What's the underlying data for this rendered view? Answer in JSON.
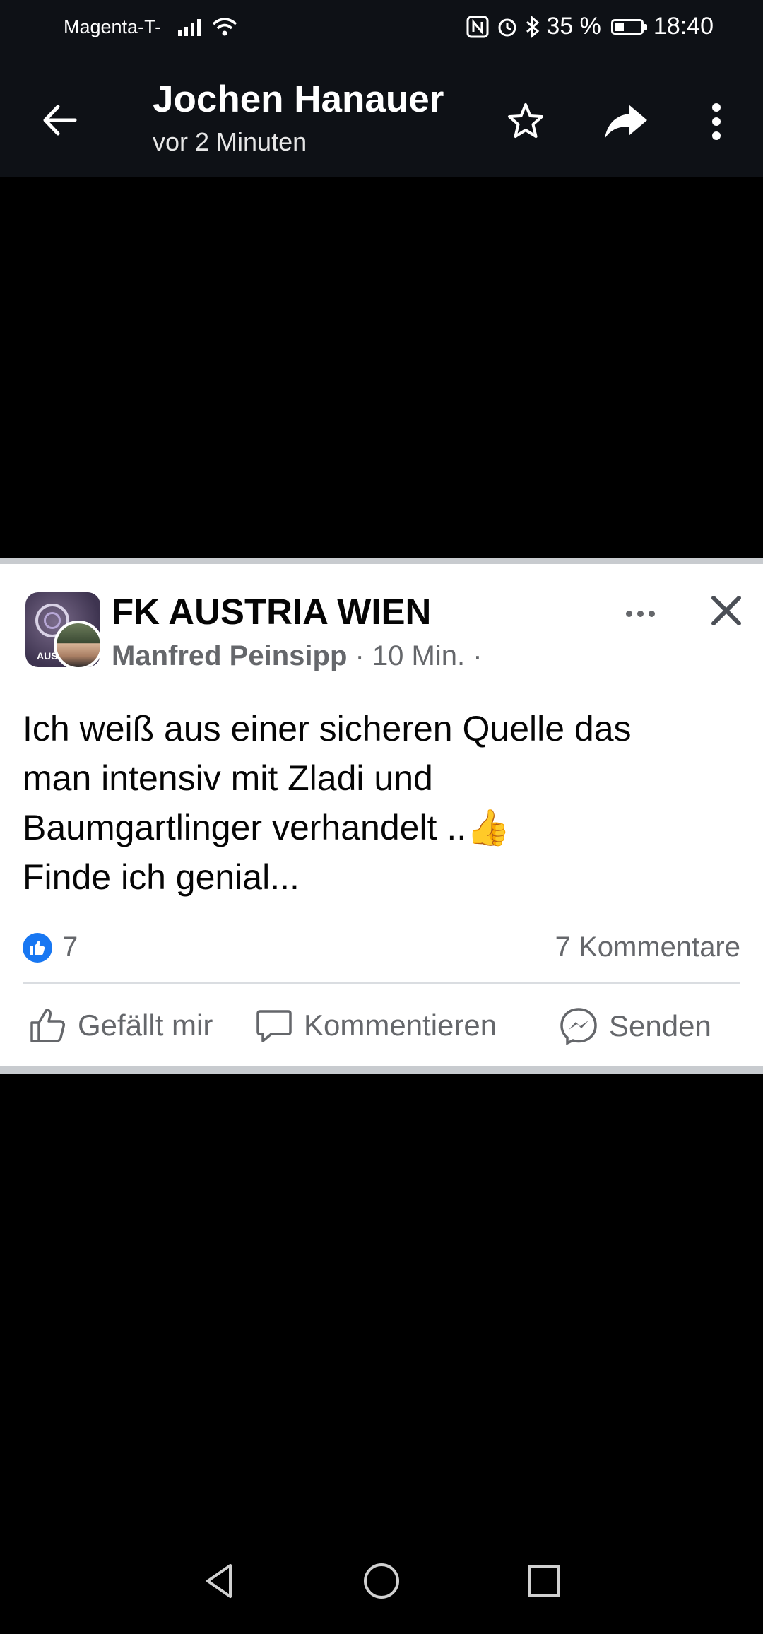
{
  "status_bar": {
    "carrier": "Magenta-T-",
    "battery": "35 %",
    "battery_level": 0.35,
    "time": "18:40"
  },
  "app_bar": {
    "title": "Jochen Hanauer",
    "subtitle": "vor 2 Minuten",
    "icons": [
      "back-arrow-icon",
      "star-icon",
      "share-icon",
      "more-vert-icon"
    ]
  },
  "post": {
    "page_name": "FK AUSTRIA WIEN",
    "author": "Manfred Peinsipp",
    "time": " · 10 Min. ·",
    "avatar_abbr": "AUS",
    "text_lines": [
      "Ich weiß aus einer sicheren Quelle das",
      "man intensiv mit Zladi und",
      "Baumgartlinger verhandelt  ..👍",
      "Finde ich genial..."
    ],
    "likes": "7",
    "comments": "7 Kommentare",
    "actions": {
      "like": "Gefällt mir",
      "comment": "Kommentieren",
      "send": "Senden"
    }
  },
  "colors": {
    "bar_bg": "#0e1116",
    "card_bg": "#ffffff",
    "like_blue": "#1877f2",
    "muted_text": "#65676b"
  }
}
